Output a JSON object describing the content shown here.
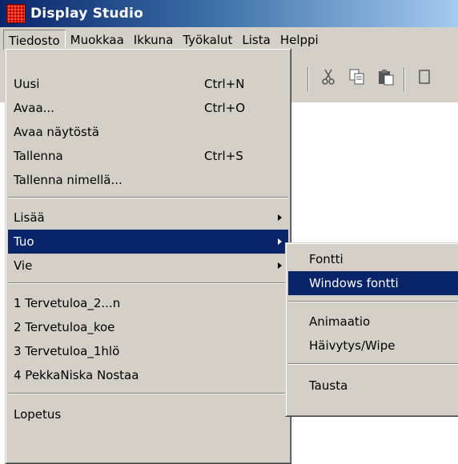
{
  "window": {
    "title": "Display Studio",
    "icon": "display-studio-icon"
  },
  "menubar": [
    "Tiedosto",
    "Muokkaa",
    "Ikkuna",
    "Työkalut",
    "Lista",
    "Helppi"
  ],
  "toolbar": {
    "icons": [
      "partial-icon",
      "cut-icon",
      "copy-icon",
      "paste-icon",
      "partial-icon-right"
    ]
  },
  "file_menu": {
    "items": [
      {
        "label": "Uusi",
        "shortcut": "Ctrl+N"
      },
      {
        "label": "Avaa...",
        "shortcut": "Ctrl+O"
      },
      {
        "label": "Avaa näytöstä",
        "shortcut": ""
      },
      {
        "label": "Tallenna",
        "shortcut": "Ctrl+S"
      },
      {
        "label": "Tallenna nimellä...",
        "shortcut": ""
      },
      {
        "label": "Lisää",
        "shortcut": "",
        "submenu": true
      },
      {
        "label": "Tuo",
        "shortcut": "",
        "submenu": true,
        "highlighted": true
      },
      {
        "label": "Vie",
        "shortcut": "",
        "submenu": true
      },
      {
        "label": "1 Tervetuloa_2...n",
        "shortcut": ""
      },
      {
        "label": "2 Tervetuloa_koe",
        "shortcut": ""
      },
      {
        "label": "3 Tervetuloa_1hlö",
        "shortcut": ""
      },
      {
        "label": "4 PekkaNiska Nostaa",
        "shortcut": ""
      },
      {
        "label": "Lopetus",
        "shortcut": ""
      }
    ]
  },
  "import_submenu": {
    "items": [
      {
        "label": "Fontti"
      },
      {
        "label": "Windows fontti",
        "highlighted": true
      },
      {
        "label": "Animaatio"
      },
      {
        "label": "Häivytys/Wipe"
      },
      {
        "label": "Tausta"
      }
    ]
  },
  "colors": {
    "highlight": "#0a246a",
    "menu_bg": "#d4d0c8",
    "title_start": "#0a246a"
  }
}
